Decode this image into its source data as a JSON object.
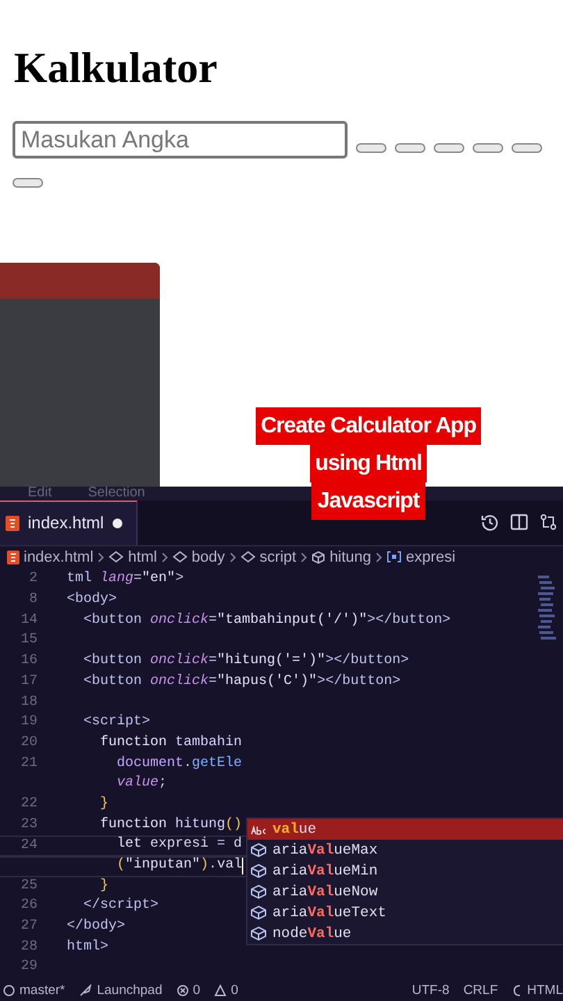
{
  "page": {
    "title": "Kalkulator",
    "input": {
      "placeholder": "Masukan Angka"
    },
    "buttons": [
      {
        "kind": "blank"
      },
      {
        "kind": "blank"
      },
      {
        "kind": "blank"
      },
      {
        "kind": "blank"
      },
      {
        "kind": "blank"
      },
      {
        "kind": "blank"
      }
    ]
  },
  "caption": {
    "lines": [
      "Create Calculator App",
      "using Html",
      "Javascript"
    ]
  },
  "editor": {
    "menu": [
      "Edit",
      "Selection"
    ],
    "tab": {
      "label": "index.html",
      "modified": true
    },
    "breadcrumb": [
      {
        "kind": "file",
        "label": "index.html"
      },
      {
        "kind": "element",
        "label": "html"
      },
      {
        "kind": "element",
        "label": "body"
      },
      {
        "kind": "element",
        "label": "script"
      },
      {
        "kind": "function",
        "label": "hitung"
      },
      {
        "kind": "variable",
        "label": "expresi"
      }
    ],
    "lines": [
      {
        "number": "2",
        "current": false,
        "cursor": false,
        "tokens": [
          {
            "kind": "tag",
            "text": "tml "
          },
          {
            "kind": "attr",
            "text": "lang"
          },
          {
            "kind": "punct",
            "text": "="
          },
          {
            "kind": "string",
            "text": "\"en\""
          },
          {
            "kind": "tag",
            "text": ">"
          }
        ]
      },
      {
        "number": "8",
        "current": false,
        "cursor": false,
        "tokens": [
          {
            "kind": "tag",
            "text": "<body>"
          }
        ]
      },
      {
        "number": "14",
        "current": false,
        "cursor": false,
        "tokens": [
          {
            "kind": "tag",
            "text": "  <button "
          },
          {
            "kind": "attr",
            "text": "onclick"
          },
          {
            "kind": "punct",
            "text": "="
          },
          {
            "kind": "string",
            "text": "\"tambahinput('/')\""
          },
          {
            "kind": "tag",
            "text": "></button>"
          }
        ]
      },
      {
        "number": "15",
        "current": false,
        "cursor": false
      },
      {
        "number": "16",
        "current": false,
        "cursor": false,
        "tokens": [
          {
            "kind": "tag",
            "text": "  <button "
          },
          {
            "kind": "attr",
            "text": "onclick"
          },
          {
            "kind": "punct",
            "text": "="
          },
          {
            "kind": "string",
            "text": "\"hitung('=')\""
          },
          {
            "kind": "tag",
            "text": "></button>"
          }
        ]
      },
      {
        "number": "17",
        "current": false,
        "cursor": false,
        "tokens": [
          {
            "kind": "tag",
            "text": "  <button "
          },
          {
            "kind": "attr",
            "text": "onclick"
          },
          {
            "kind": "punct",
            "text": "="
          },
          {
            "kind": "string",
            "text": "\"hapus('C')\""
          },
          {
            "kind": "tag",
            "text": "></button>"
          }
        ]
      },
      {
        "number": "18",
        "current": false,
        "cursor": false
      },
      {
        "number": "19",
        "current": false,
        "cursor": false,
        "tokens": [
          {
            "kind": "tag",
            "text": "  <script>"
          }
        ]
      },
      {
        "number": "20",
        "current": false,
        "cursor": false,
        "tokens": [
          {
            "kind": "keyword",
            "text": "    function "
          },
          {
            "kind": "function",
            "text": "tambahin"
          }
        ]
      },
      {
        "number": "21",
        "current": false,
        "cursor": false,
        "tokens": [
          {
            "kind": "object",
            "text": "      document"
          },
          {
            "kind": "punct",
            "text": "."
          },
          {
            "kind": "method",
            "text": "getEle"
          }
        ]
      },
      {
        "current": false,
        "cursor": false,
        "tokens": [
          {
            "kind": "variable",
            "text": "      value"
          },
          {
            "kind": "punct",
            "text": ";"
          }
        ]
      },
      {
        "number": "22",
        "current": false,
        "cursor": false,
        "tokens": [
          {
            "kind": "brace",
            "text": "    }"
          }
        ]
      },
      {
        "number": "23",
        "current": false,
        "cursor": false,
        "tokens": [
          {
            "kind": "keyword",
            "text": "    function "
          },
          {
            "kind": "function",
            "text": "hitung"
          },
          {
            "kind": "brace",
            "text": "()"
          }
        ]
      },
      {
        "number": "24",
        "current": true,
        "cursor": false,
        "tokens": [
          {
            "kind": "keyword",
            "text": "      let "
          },
          {
            "kind": "plain",
            "text": "expresi "
          },
          {
            "kind": "punct",
            "text": "= "
          },
          {
            "kind": "plain",
            "text": "d"
          }
        ]
      },
      {
        "current": true,
        "cursor": true,
        "tokens": [
          {
            "kind": "brace",
            "text": "      ("
          },
          {
            "kind": "string",
            "text": "\"inputan\""
          },
          {
            "kind": "brace",
            "text": ")"
          },
          {
            "kind": "punct",
            "text": "."
          },
          {
            "kind": "plain",
            "text": "val"
          }
        ]
      },
      {
        "number": "25",
        "current": false,
        "cursor": false,
        "tokens": [
          {
            "kind": "brace",
            "text": "    }"
          }
        ]
      },
      {
        "number": "26",
        "current": false,
        "cursor": false,
        "tokens": [
          {
            "kind": "tag",
            "text": "  </script>"
          }
        ]
      },
      {
        "number": "27",
        "current": false,
        "cursor": false,
        "tokens": [
          {
            "kind": "tag",
            "text": "</body>"
          }
        ]
      },
      {
        "number": "28",
        "current": false,
        "cursor": false,
        "tokens": [
          {
            "kind": "tag",
            "text": "html>"
          }
        ]
      },
      {
        "number": "29",
        "current": false,
        "cursor": false
      }
    ],
    "suggestions": [
      {
        "kind": "text",
        "label": "**val**ue",
        "selected": true
      },
      {
        "kind": "property",
        "label": "aria**Val**ueMax",
        "selected": false
      },
      {
        "kind": "property",
        "label": "aria**Val**ueMin",
        "selected": false
      },
      {
        "kind": "property",
        "label": "aria**Val**ueNow",
        "selected": false
      },
      {
        "kind": "property",
        "label": "aria**Val**ueText",
        "selected": false
      },
      {
        "kind": "property",
        "label": "node**Val**ue",
        "selected": false
      }
    ],
    "status_bar": [
      {
        "kind": "branch",
        "label": "master*"
      },
      {
        "kind": "launch",
        "label": "Launchpad"
      },
      {
        "kind": "errors",
        "label": "0"
      },
      {
        "kind": "warnings",
        "label": "0"
      },
      {
        "kind": "plain",
        "label": "UTF-8"
      },
      {
        "kind": "plain",
        "label": "CRLF"
      },
      {
        "kind": "language",
        "label": "HTML"
      }
    ]
  }
}
